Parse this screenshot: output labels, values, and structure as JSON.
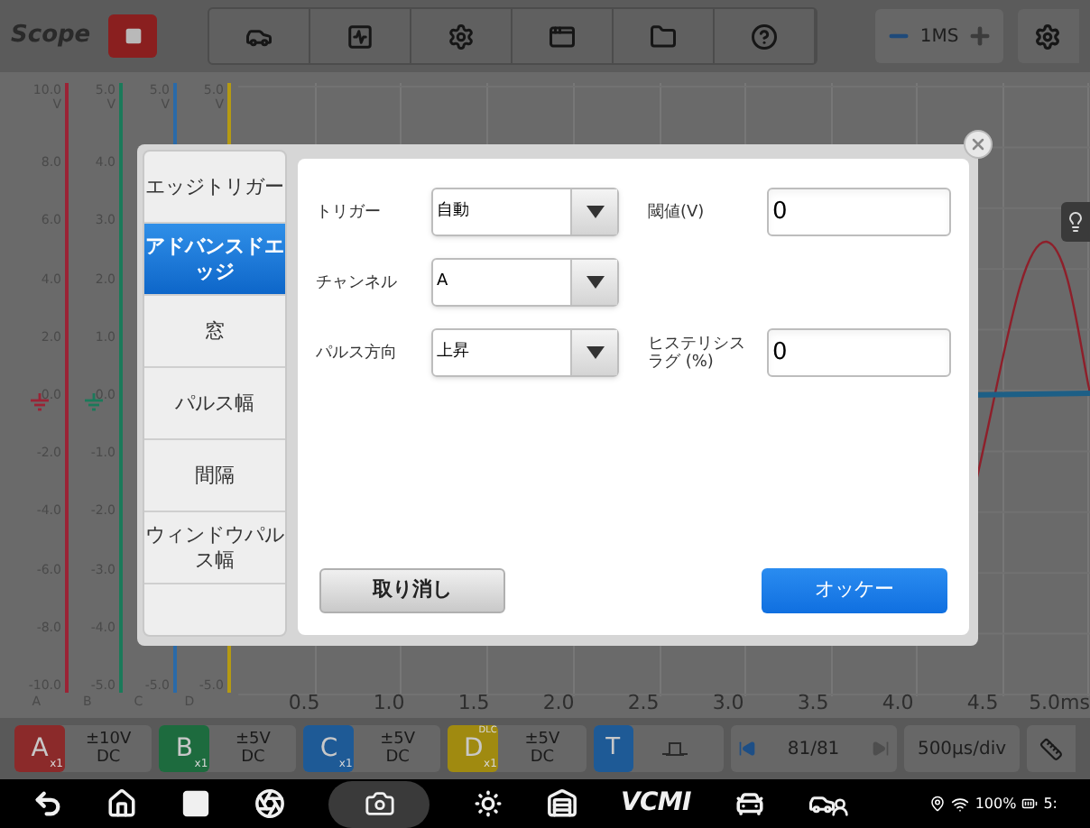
{
  "top_bar": {
    "title": "Scope",
    "time_scale": "1MS"
  },
  "y_axes": [
    {
      "channel": "A",
      "color": "#9b2335",
      "unit": "V",
      "labels": [
        "10.0",
        "8.0",
        "6.0",
        "4.0",
        "2.0",
        "0.0",
        "-2.0",
        "-4.0",
        "-6.0",
        "-8.0",
        "-10.0"
      ]
    },
    {
      "channel": "B",
      "color": "#1b7a5a",
      "unit": "V",
      "labels": [
        "5.0",
        "4.0",
        "3.0",
        "2.0",
        "1.0",
        "0.0",
        "-1.0",
        "-2.0",
        "-3.0",
        "-4.0",
        "-5.0"
      ]
    },
    {
      "channel": "C",
      "color": "#2a6aa8",
      "unit": "V",
      "labels": [
        "5.0",
        "-5.0"
      ]
    },
    {
      "channel": "D",
      "color": "#b59a12",
      "unit": "V",
      "labels": [
        "5.0",
        "-5.0"
      ]
    }
  ],
  "x_axis": {
    "labels": [
      "0.5",
      "1.0",
      "1.5",
      "2.0",
      "2.5",
      "3.0",
      "3.5",
      "4.0",
      "4.5",
      "5.0ms"
    ]
  },
  "dialog": {
    "tabs": [
      {
        "label": "エッジトリガー",
        "selected": false
      },
      {
        "label": "アドバンスドエッジ",
        "selected": true
      },
      {
        "label": "窓",
        "selected": false
      },
      {
        "label": "パルス幅",
        "selected": false
      },
      {
        "label": "間隔",
        "selected": false
      },
      {
        "label": "ウィンドウパルス幅",
        "selected": false
      }
    ],
    "rows": [
      [
        {
          "kind": "select",
          "label": "トリガー",
          "value": "自動"
        },
        {
          "kind": "input",
          "label": "閾値(V)",
          "value": "0"
        }
      ],
      [
        {
          "kind": "select",
          "label": "チャンネル",
          "value": "A"
        }
      ],
      [
        {
          "kind": "select",
          "label": "パルス方向",
          "value": "上昇"
        },
        {
          "kind": "input",
          "label": "ヒステリシスラグ (%)",
          "value": "0"
        }
      ]
    ],
    "buttons": [
      {
        "kind": "secondary",
        "label": "取り消し"
      },
      {
        "kind": "primary",
        "label": "オッケー"
      }
    ]
  },
  "channel_bar": {
    "channels": [
      {
        "letter": "A",
        "probe": "x1",
        "range": "±10V",
        "coupling": "DC",
        "color": "#8b2a2a"
      },
      {
        "letter": "B",
        "probe": "x1",
        "range": "±5V",
        "coupling": "DC",
        "color": "#1d6b3e"
      },
      {
        "letter": "C",
        "probe": "x1",
        "range": "±5V",
        "coupling": "DC",
        "color": "#1e5a96"
      },
      {
        "letter": "D",
        "probe": "x1",
        "badge": "DLC",
        "range": "±5V",
        "coupling": "DC",
        "color": "#a08a10"
      }
    ],
    "trigger": "T",
    "frame": "81/81",
    "timebase": "500µs/div"
  },
  "nav_bar": {
    "logo": "VCMI"
  },
  "status_bar": {
    "battery": "100%",
    "time": "5:"
  }
}
